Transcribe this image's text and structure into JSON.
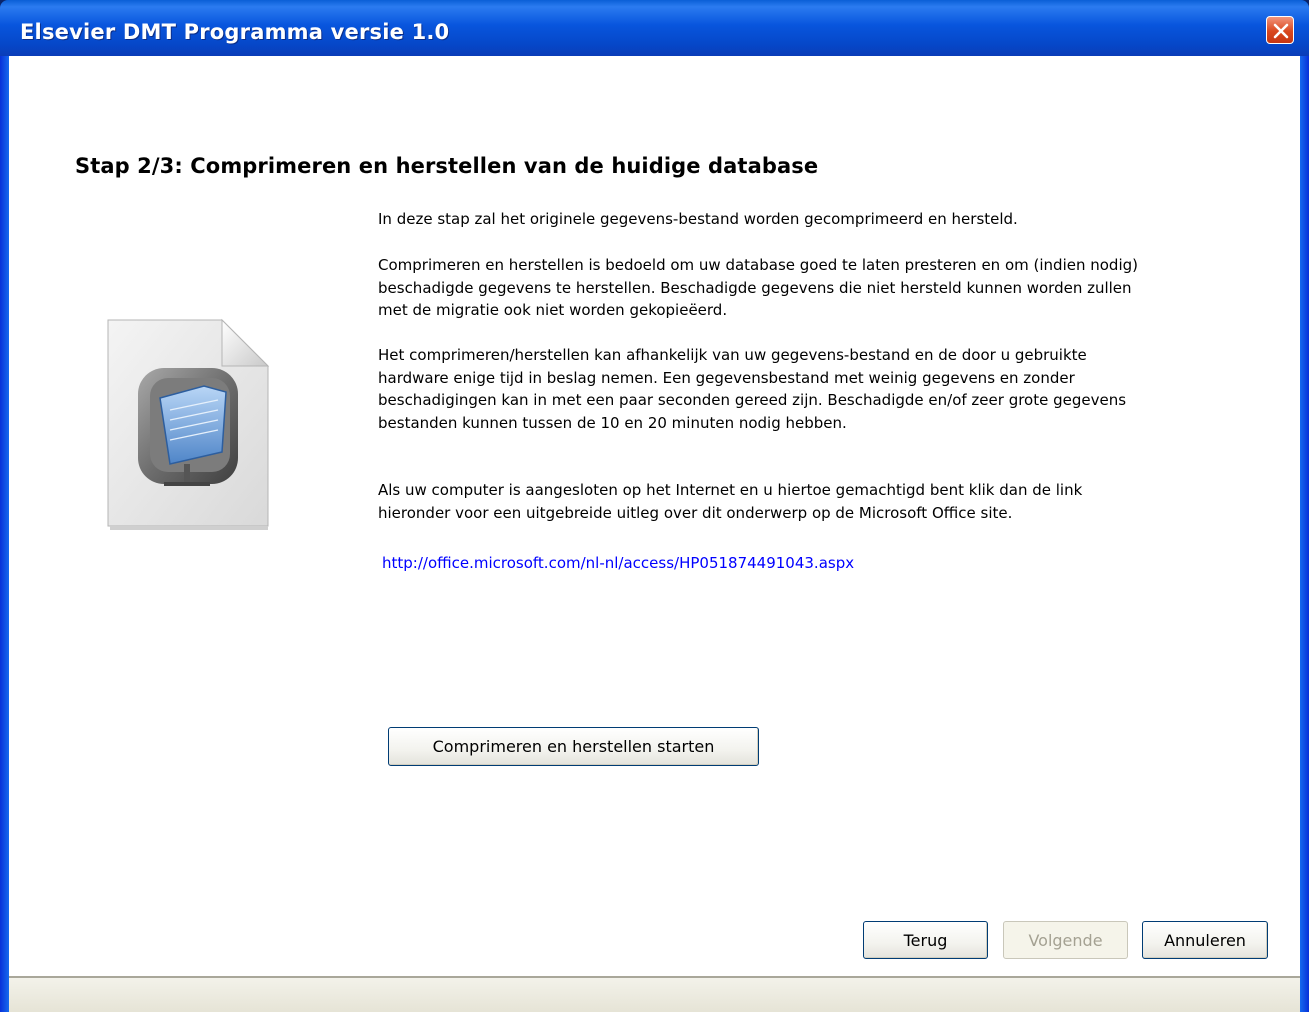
{
  "window": {
    "title": "Elsevier DMT Programma versie 1.0"
  },
  "content": {
    "heading": "Stap 2/3: Comprimeren en herstellen van de huidige database",
    "paragraphs": [
      "In deze stap zal het originele gegevens-bestand worden gecomprimeerd en hersteld.",
      "Comprimeren en herstellen is bedoeld om uw database goed te laten presteren en om (indien nodig) beschadigde gegevens te herstellen. Beschadigde gegevens die niet hersteld kunnen worden zullen met de migratie ook niet worden gekopieëerd.",
      "Het comprimeren/herstellen kan afhankelijk van uw gegevens-bestand en de door u gebruikte hardware enige tijd in beslag nemen. Een gegevensbestand met weinig gegevens en zonder beschadigingen kan in met een paar seconden gereed zijn. Beschadigde en/of zeer grote gegevens bestanden kunnen tussen de 10 en 20 minuten nodig hebben.",
      "Als uw computer is aangesloten op het Internet en u hiertoe gemachtigd bent klik dan de link hieronder voor een uitgebreide uitleg over dit onderwerp op de Microsoft Office site."
    ],
    "link": "http://office.microsoft.com/nl-nl/access/HP051874491043.aspx",
    "action_button": "Comprimeren en herstellen starten"
  },
  "nav": {
    "back": "Terug",
    "next": "Volgende",
    "cancel": "Annuleren"
  },
  "icons": {
    "close": "close-icon",
    "document": "database-document-icon"
  },
  "colors": {
    "titlebar": "#0855dd",
    "link": "#0000ff",
    "close": "#d9481f"
  }
}
